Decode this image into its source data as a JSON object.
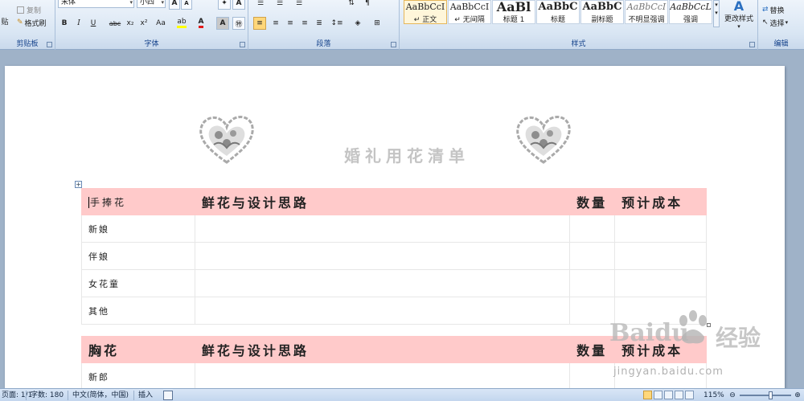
{
  "ribbon": {
    "clipboard": {
      "paste_label": "贴",
      "copy_label": "复制",
      "format_painter_label": "格式刷",
      "group_label": "剪贴板"
    },
    "font": {
      "font_name": "宋体",
      "font_size": "小四",
      "group_label": "字体"
    },
    "paragraph": {
      "group_label": "段落"
    },
    "styles": {
      "tiles": [
        {
          "sample": "AaBbCcI",
          "name": "↵ 正文"
        },
        {
          "sample": "AaBbCcI",
          "name": "↵ 无间隔"
        },
        {
          "sample": "AaBl",
          "name": "标题 1"
        },
        {
          "sample": "AaBbC",
          "name": "标题"
        },
        {
          "sample": "AaBbC",
          "name": "副标题"
        },
        {
          "sample": "AaBbCcI",
          "name": "不明显强调"
        },
        {
          "sample": "AaBbCcL",
          "name": "强调"
        }
      ],
      "change_styles_label": "更改样式",
      "group_label": "样式"
    },
    "editing": {
      "replace_label": "替换",
      "select_label": "选择",
      "group_label": "编辑"
    }
  },
  "document": {
    "title": "婚礼用花清单",
    "table1": {
      "headers": [
        "手捧花",
        "鲜花与设计思路",
        "数量",
        "预计成本"
      ],
      "rows": [
        "新娘",
        "伴娘",
        "女花童",
        "其他"
      ]
    },
    "table2": {
      "headers": [
        "胸花",
        "鲜花与设计思路",
        "数量",
        "预计成本"
      ],
      "rows": [
        "新郎"
      ]
    }
  },
  "watermark": {
    "brand": "Baidu",
    "brand_cn": "经验",
    "url": "jingyan.baidu.com"
  },
  "statusbar": {
    "page": "页面: 1/1",
    "words": "字数: 180",
    "language": "中文(简体，中国)",
    "mode": "插入",
    "zoom": "115%"
  }
}
